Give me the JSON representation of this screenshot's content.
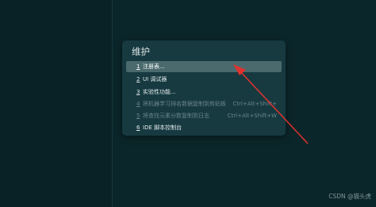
{
  "panel": {
    "title": "维护",
    "items": [
      {
        "num": "1",
        "label": "注册表...",
        "shortcut": "",
        "enabled": true,
        "selected": true
      },
      {
        "num": "2",
        "label": "UI 调试器",
        "shortcut": "",
        "enabled": true,
        "selected": false
      },
      {
        "num": "3",
        "label": "实验性功能...",
        "shortcut": "",
        "enabled": true,
        "selected": false
      },
      {
        "num": "4",
        "label": "将机器学习排名数据复制到剪贴板",
        "shortcut": "Ctrl+Alt+Shift+",
        "enabled": false,
        "selected": false
      },
      {
        "num": "5",
        "label": "将查找元素分数复制到日志",
        "shortcut": "Ctrl+Alt+Shift+W",
        "enabled": false,
        "selected": false
      },
      {
        "num": "6",
        "label": "IDE 脚本控制台",
        "shortcut": "",
        "enabled": true,
        "selected": false
      }
    ]
  },
  "watermark": "CSDN @猫头虎",
  "colors": {
    "background": "#0b262a",
    "panel": "#163a40",
    "selected_item": "#4a6a6e",
    "arrow": "#e0332f"
  }
}
